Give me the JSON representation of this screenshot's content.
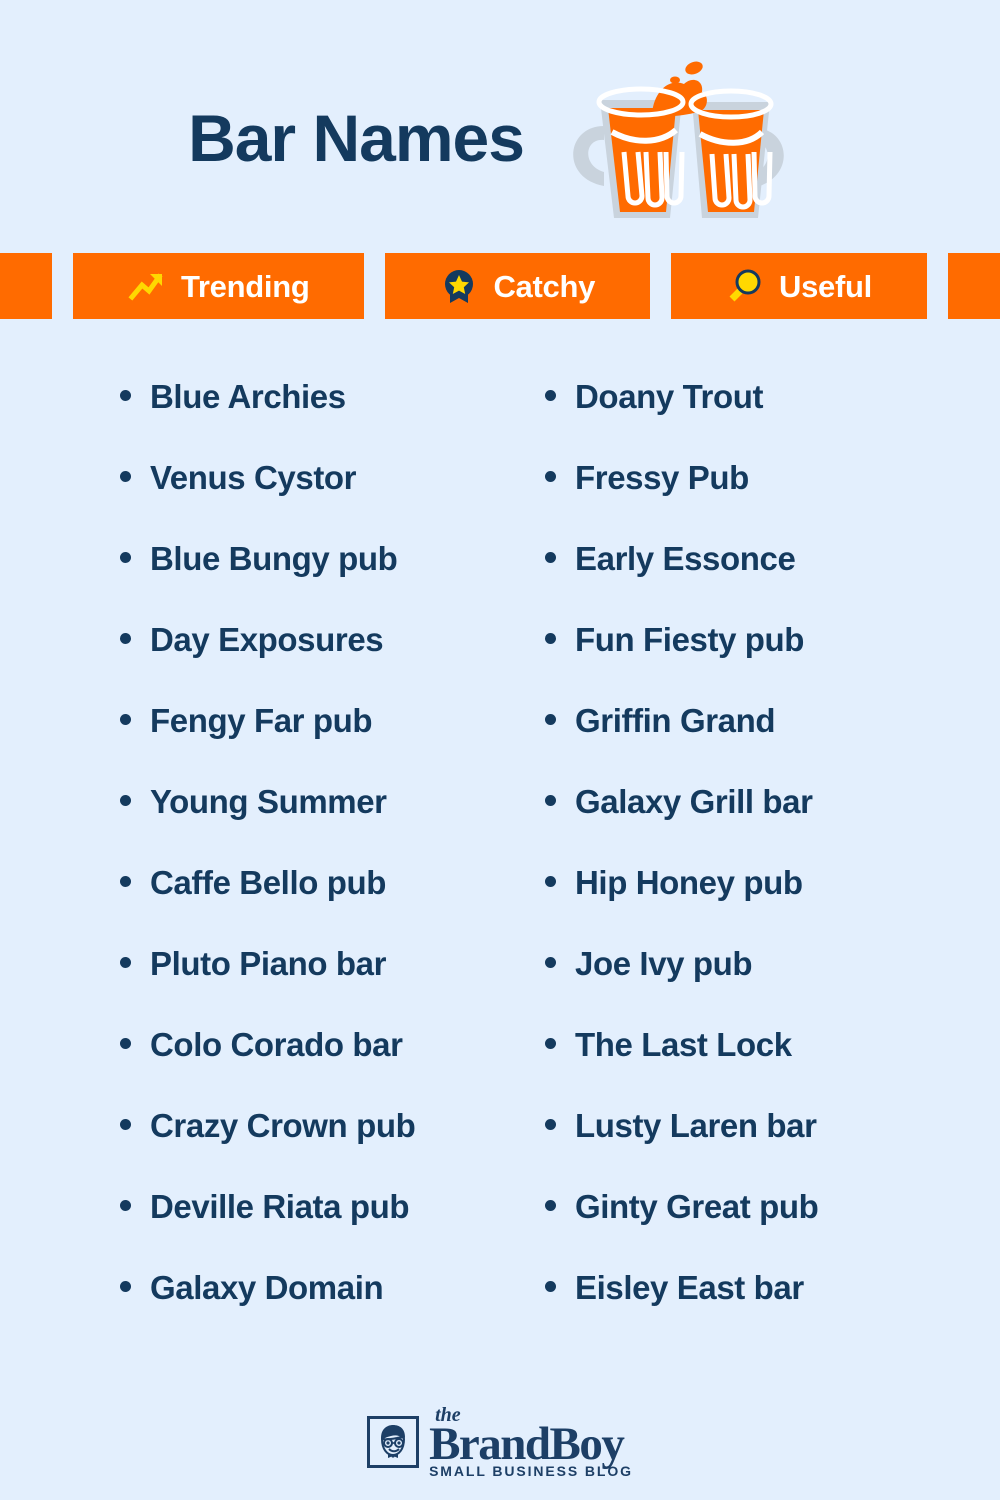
{
  "page": {
    "title": "Bar Names",
    "background_color": "#e3effd",
    "accent_color": "#ff6b00",
    "text_color": "#143a5e",
    "icon_accent_color": "#ffd800",
    "hero_icon": "beer-mugs-cheers-icon"
  },
  "badges": [
    {
      "label": "Trending",
      "icon": "trending-up-icon"
    },
    {
      "label": "Catchy",
      "icon": "award-star-icon"
    },
    {
      "label": "Useful",
      "icon": "magnifying-glass-icon"
    }
  ],
  "columns": [
    {
      "items": [
        "Blue Archies",
        "Venus Cystor",
        "Blue Bungy pub",
        "Day Exposures",
        "Fengy Far pub",
        "Young Summer",
        "Caffe Bello pub",
        "Pluto Piano bar",
        "Colo Corado bar",
        "Crazy Crown pub",
        "Deville Riata pub",
        "Galaxy Domain"
      ]
    },
    {
      "items": [
        "Doany Trout",
        "Fressy Pub",
        "Early Essonce",
        "Fun Fiesty pub",
        "Griffin Grand",
        "Galaxy Grill bar",
        "Hip Honey pub",
        "Joe Ivy pub",
        "The Last Lock",
        "Lusty Laren bar",
        "Ginty Great pub",
        "Eisley East bar"
      ]
    }
  ],
  "footer": {
    "logo_the": "the",
    "logo_main": "BrandBoy",
    "logo_sub": "SMALL BUSINESS BLOG",
    "logo_mark": "boy-face-icon"
  }
}
